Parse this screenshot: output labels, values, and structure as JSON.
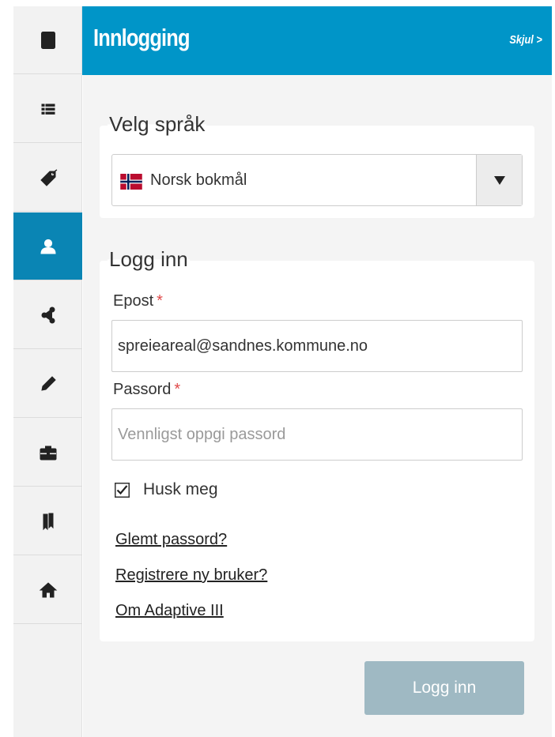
{
  "header": {
    "title": "Innlogging",
    "hide_label": "Skjul >",
    "color": "#0095c8"
  },
  "sidebar": {
    "items": [
      {
        "icon": "document-icon",
        "active": false
      },
      {
        "icon": "list-icon",
        "active": false
      },
      {
        "icon": "tag-icon",
        "active": false
      },
      {
        "icon": "user-icon",
        "active": true
      },
      {
        "icon": "share-icon",
        "active": false
      },
      {
        "icon": "pencil-icon",
        "active": false
      },
      {
        "icon": "briefcase-icon",
        "active": false
      },
      {
        "icon": "bookmarks-icon",
        "active": false
      },
      {
        "icon": "home-icon",
        "active": false
      }
    ],
    "active_color": "#0a85b4"
  },
  "language": {
    "legend": "Velg språk",
    "selected": "Norsk bokmål",
    "flag": "norway-flag-icon"
  },
  "login": {
    "legend": "Logg inn",
    "email_label": "Epost",
    "email_required": "*",
    "email_value": "spreieareal@sandnes.kommune.no",
    "password_label": "Passord",
    "password_required": "*",
    "password_placeholder": "Vennligst oppgi passord",
    "remember_label": "Husk meg",
    "remember_checked": true,
    "links": {
      "forgot": "Glemt passord?",
      "register": "Registrere ny bruker?",
      "about": "Om Adaptive III"
    },
    "submit_label": "Logg inn",
    "submit_color": "#9fb9c3"
  }
}
